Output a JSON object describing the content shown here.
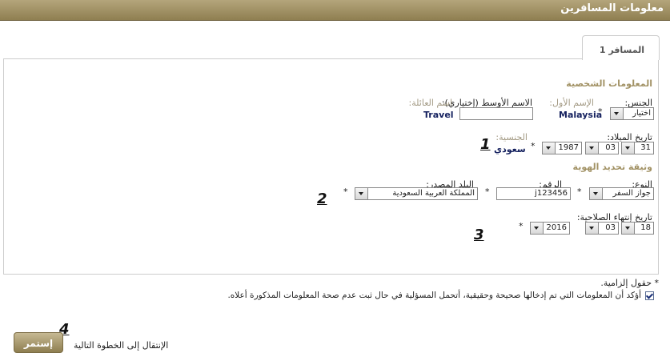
{
  "header": {
    "title": "معلومات المسافرين"
  },
  "tab": {
    "label": "المسافر 1"
  },
  "personal": {
    "section_title": "المعلومات الشخصية",
    "gender_label": "الجنس:",
    "gender_value": "اختيار",
    "first_name_label": "الإسم الأول:",
    "first_name_value": "Malaysia",
    "middle_name_label": "الاسم الأوسط (إختياري):",
    "middle_name_value": "",
    "family_name_label": "اسم العائلة:",
    "family_name_value": "Travel",
    "dob_label": "تاريخ الميلاد:",
    "dob_day": "31",
    "dob_month": "03",
    "dob_year": "1987",
    "nationality_label": "الجنسية:",
    "nationality_value": "سعودي"
  },
  "id_doc": {
    "section_title": "وثيقة تحديد الهوية",
    "type_label": "النوع:",
    "type_value": "جواز السفر",
    "number_label": "الرقم:",
    "number_value": "j123456",
    "issuer_label": "البلد المصدر:",
    "issuer_value": "المملكة العربية السعودية",
    "expiry_label": "تاريخ إنتهاء الصلاحية:",
    "expiry_day": "18",
    "expiry_month": "03",
    "expiry_year": "2016"
  },
  "required_star": "*",
  "markers": {
    "m1": "1",
    "m2": "2",
    "m3": "3",
    "m4": "4"
  },
  "footer": {
    "required_note": "* حقول إلزامية.",
    "confirm_text": "أؤكد أن المعلومات التي تم إدخالها صحيحة وحقيقية، أتحمل المسؤلية في حال ثبت عدم صحة المعلومات المذكورة أعلاه.",
    "confirm_checked": true,
    "next_step_text": "الإنتقال إلى الخطوة التالية",
    "continue_label": "إستمر"
  }
}
